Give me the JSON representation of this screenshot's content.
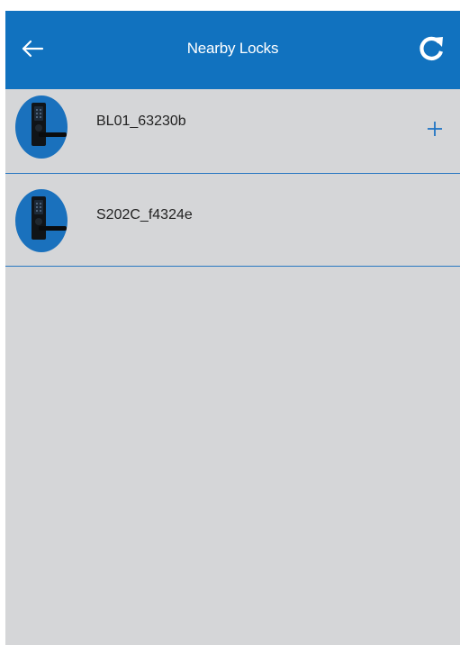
{
  "app": {
    "title": "Nearby Locks"
  },
  "header": {
    "back_icon": "arrow-left-icon",
    "refresh_icon": "refresh-icon"
  },
  "locks": [
    {
      "name": "BL01_63230b",
      "icon": "door-lock-icon",
      "action_icon": "plus-icon",
      "show_add": true
    },
    {
      "name": "S202C_f4324e",
      "icon": "door-lock-icon",
      "show_add": false
    }
  ],
  "colors": {
    "header_bg": "#1172bf",
    "list_bg": "#d5d6d8",
    "accent": "#1a71bd",
    "divider": "#2a78c2"
  }
}
